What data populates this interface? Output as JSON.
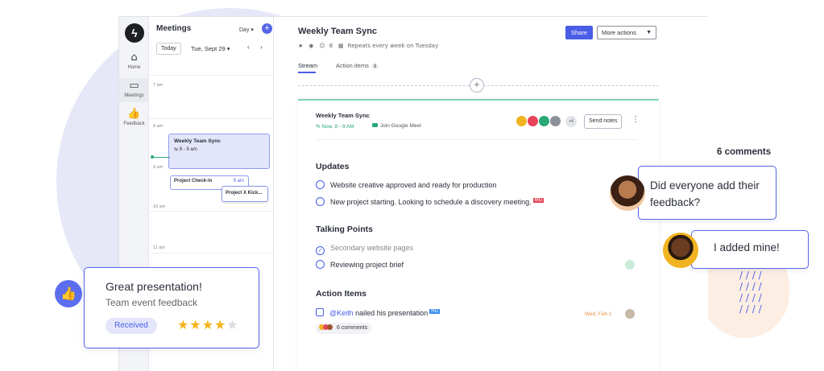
{
  "nav": {
    "items": [
      {
        "label": "Home",
        "icon": "home-icon"
      },
      {
        "label": "Meetings",
        "icon": "calendar-icon"
      },
      {
        "label": "Feedback",
        "icon": "thumbs-up-icon"
      }
    ]
  },
  "calendar": {
    "title": "Meetings",
    "view": "Day ▾",
    "add": "+",
    "more": "⋮",
    "today_label": "Today",
    "date": "Tue, Sept 29 ▾",
    "prev": "‹",
    "next": "›",
    "hours": [
      "7 am",
      "8 am",
      "9 am",
      "10 am",
      "11 am"
    ],
    "events": {
      "main": {
        "title": "Weekly Team Sync",
        "time": "8 - 9 am"
      },
      "check_in": {
        "title": "Project Check-in",
        "time": "9 am"
      },
      "project_x": {
        "title": "Project X Kick..."
      }
    }
  },
  "main": {
    "title": "Weekly Team Sync",
    "meta_count": "8",
    "meta_repeat": "Repeats every week on Tuesday",
    "share_label": "Share",
    "more_actions_label": "More actions",
    "tabs": [
      {
        "label": "Stream"
      },
      {
        "label": "Action items",
        "badge": "9"
      }
    ]
  },
  "card": {
    "title": "Weekly Team Sync",
    "time": "Now, 8 - 9 AM",
    "meet_link": "Join Google Meet",
    "avatar_more": "+4",
    "send_notes": "Send notes",
    "sections": {
      "updates": {
        "title": "Updates",
        "items": [
          {
            "text": "Website creative approved and ready for production"
          },
          {
            "text": "New project starting. Looking to schedule a discovery meeting.",
            "tag": "MG"
          }
        ]
      },
      "talking_points": {
        "title": "Talking Points",
        "items": [
          {
            "text": "Secondary website pages",
            "done": true
          },
          {
            "text": "Reviewing project brief",
            "done": false
          }
        ]
      },
      "action_items": {
        "title": "Action Items",
        "item": {
          "mention": "@Keith",
          "text": "nailed his presentation",
          "tag": "HD",
          "due": "Wed, Feb 1"
        },
        "comments": "6 comments"
      }
    }
  },
  "overlay": {
    "comments_count": "6 comments",
    "bubble1": "Did everyone add their feedback?",
    "bubble2": "I added mine!",
    "review": {
      "title": "Great presentation!",
      "subtitle": "Team event feedback",
      "badge": "Received",
      "rating": 4,
      "rating_max": 5
    }
  },
  "colors": {
    "accent": "#4a5de6",
    "now_green": "#2aa876",
    "due_orange": "#e8913c",
    "tag_red": "#e8445a",
    "tag_blue": "#3a8ef0",
    "star": "#f6b21b"
  }
}
